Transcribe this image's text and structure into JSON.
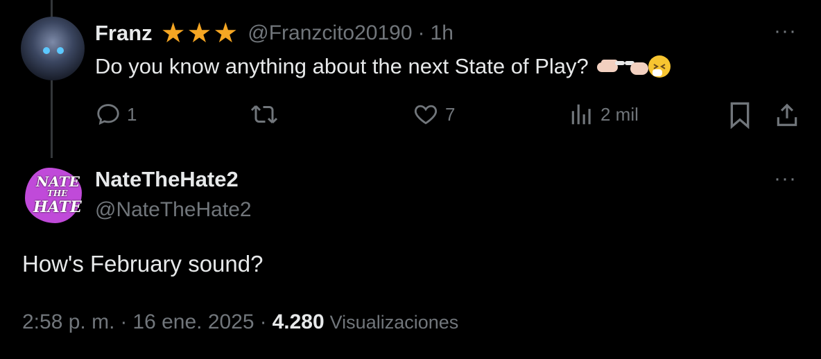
{
  "reply_to": {
    "name": "Franz",
    "badge_stars": 3,
    "handle": "@Franzcito20190",
    "separator": "·",
    "time": "1h",
    "text": "Do you know anything about the next State of Play?",
    "actions": {
      "replies": "1",
      "reposts": "",
      "likes": "7",
      "views": "2 mil"
    }
  },
  "tweet": {
    "name": "NateTheHate2",
    "handle": "@NateTheHate2",
    "avatar_text": [
      "NATE",
      "THE",
      "HATE"
    ],
    "text": "How's February sound?",
    "time": "2:58 p. m.",
    "sep1": "·",
    "date": "16 ene. 2025",
    "sep2": "·",
    "views_count": "4.280",
    "views_label": "Visualizaciones"
  },
  "more_icon": "···",
  "colors": {
    "star": "#f5a623",
    "muted": "#71767b",
    "text": "#e7e9ea",
    "avatar_purple": "#c04ad9"
  }
}
